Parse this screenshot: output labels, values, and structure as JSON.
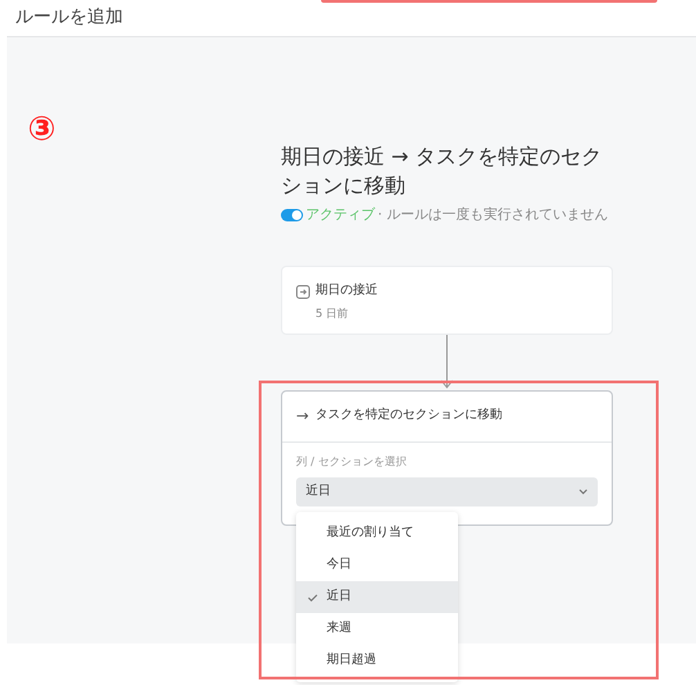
{
  "header": {
    "title": "ルールを追加"
  },
  "step_marker": "③",
  "rule": {
    "title": "期日の接近 → タスクを特定のセクションに移動",
    "active": true,
    "status_label": "アクティブ",
    "status_message": "· ルールは一度も実行されていません"
  },
  "trigger": {
    "title": "期日の接近",
    "detail": "5 日前"
  },
  "action": {
    "arrow": "→",
    "title": "タスクを特定のセクションに移動",
    "field_label": "列 / セクションを選択",
    "value": "近日"
  },
  "options": [
    {
      "label": "最近の割り当て",
      "selected": false
    },
    {
      "label": "今日",
      "selected": false
    },
    {
      "label": "近日",
      "selected": true
    },
    {
      "label": "来週",
      "selected": false
    },
    {
      "label": "期日超過",
      "selected": false
    }
  ]
}
